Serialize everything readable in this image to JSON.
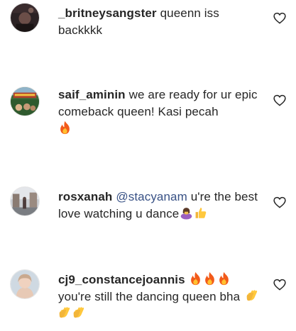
{
  "comments": [
    {
      "username": "_britneysangster",
      "text": "queenn iss backkkk",
      "avatar": "dark-photo-avatar",
      "icon": "heart-icon"
    },
    {
      "username": "saif_aminin",
      "text": "we are ready for ur epic comeback queen! Kasi pecah",
      "emojis_after": [
        "fire"
      ],
      "avatar": "restaurant-sign-avatar",
      "icon": "heart-icon"
    },
    {
      "username": "rosxanah",
      "mention": "@stacyanam",
      "text": "u're the best love watching u dance",
      "emojis_after": [
        "woman-bowing",
        "thumbs-up"
      ],
      "avatar": "city-street-avatar",
      "icon": "heart-icon"
    },
    {
      "username": "cj9_constancejoannis",
      "text": "you're still the dancing queen bha",
      "emojis_after_username": [
        "fire",
        "fire",
        "fire"
      ],
      "emojis_after": [
        "clapping-hands",
        "clapping-hands",
        "clapping-hands"
      ],
      "avatar": "selfie-avatar",
      "icon": "heart-icon"
    }
  ],
  "colors": {
    "text": "#262626",
    "mention": "#385185",
    "heart_outline": "#262626"
  }
}
